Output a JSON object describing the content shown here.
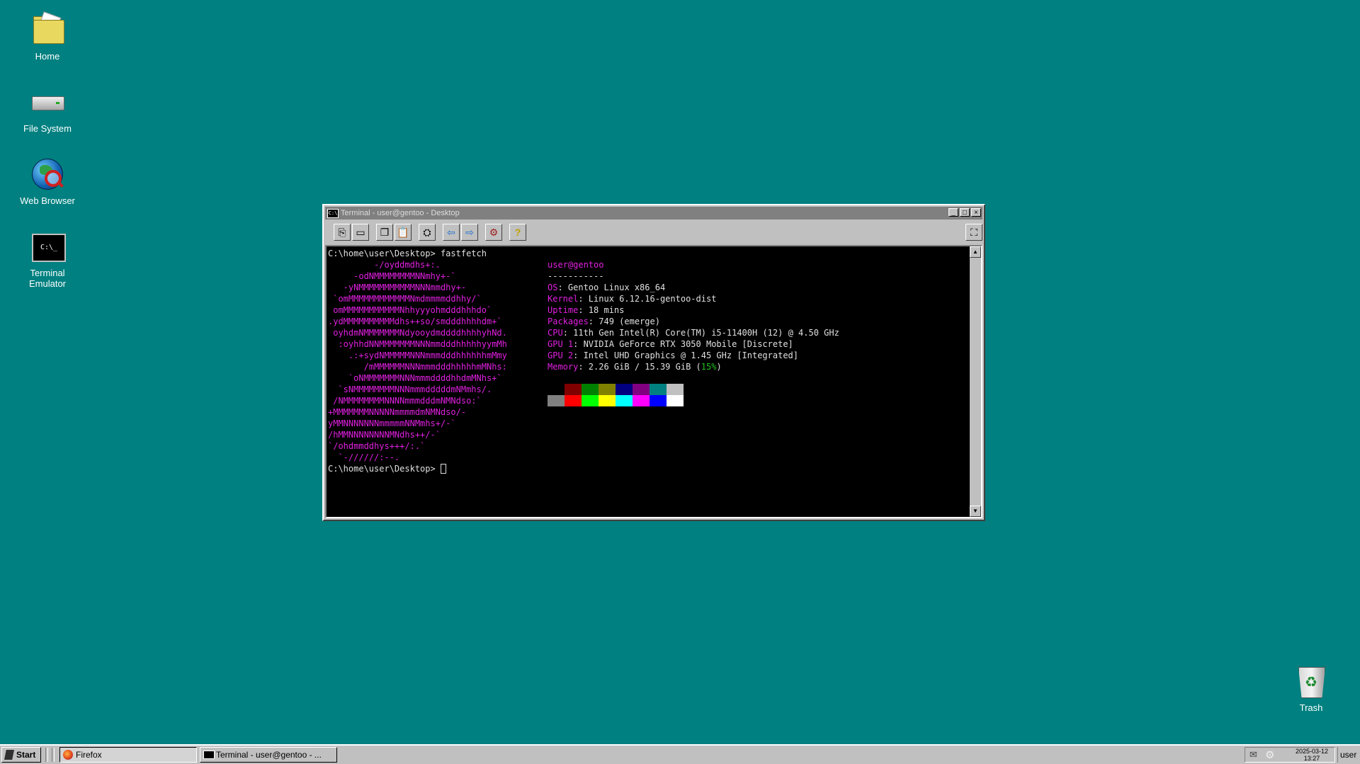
{
  "desktop": {
    "icons": [
      {
        "label": "Home",
        "icon": "folder-icon"
      },
      {
        "label": "File System",
        "icon": "drive-icon"
      },
      {
        "label": "Web Browser",
        "icon": "globe-icon"
      },
      {
        "label": "Terminal Emulator",
        "icon": "terminal-icon"
      },
      {
        "label": "Trash",
        "icon": "trash-icon"
      }
    ]
  },
  "terminal": {
    "title": "Terminal - user@gentoo - Desktop",
    "title_icon_text": "C:\\",
    "icon_text": "C:\\_",
    "prompt1": "C:\\home\\user\\Desktop> fastfetch",
    "prompt2": "C:\\home\\user\\Desktop> ",
    "logo_lines": [
      "         -/oyddmdhs+:.",
      "     -odNMMMMMMMMNNmhy+-`",
      "   -yNMMMMMMMMMMMNNNmmdhy+-",
      " `omMMMMMMMMMMMMNmdmmmmddhhy/`",
      " omMMMMMMMMMMMNhhyyyohmdddhhhdo`",
      ".ydMMMMMMMMMMdhs++so/smdddhhhhdm+`",
      " oyhdmNMMMMMMMNdyooydmddddhhhhyhNd.",
      "  :oyhhdNNMMMMMMMNNNmmdddhhhhhyymMh",
      "    .:+sydNMMMMMNNNmmmdddhhhhhhmMmy",
      "       /mMMMMMMNNNmmmdddhhhhhmMNhs:",
      "    `oNMMMMMMMNNNmmmddddhhdmMNhs+`",
      "  `sNMMMMMMMMNNNmmmdddddmNMmhs/.",
      " /NMMMMMMMMNNNNmmmdddmNMNdso:`",
      "+MMMMMMMNNNNNmmmmdmNMNdso/-",
      "yMMNNNNNNNmmmmmNNMmhs+/-`",
      "/hMMNNNNNNNNMNdhs++/-`",
      "`/ohdmmddhys+++/:.`",
      "  `-//////:--."
    ],
    "user_host": "user@gentoo",
    "separator": "-----------",
    "info": [
      {
        "key": "OS",
        "value": ": Gentoo Linux x86_64"
      },
      {
        "key": "Kernel",
        "value": ": Linux 6.12.16-gentoo-dist"
      },
      {
        "key": "Uptime",
        "value": ": 18 mins"
      },
      {
        "key": "Packages",
        "value": ": 749 (emerge)"
      },
      {
        "key": "CPU",
        "value": ": 11th Gen Intel(R) Core(TM) i5-11400H (12) @ 4.50 GHz"
      },
      {
        "key": "GPU 1",
        "value": ": NVIDIA GeForce RTX 3050 Mobile [Discrete]"
      },
      {
        "key": "GPU 2",
        "value": ": Intel UHD Graphics @ 1.45 GHz [Integrated]"
      },
      {
        "key": "Memory",
        "value": ": 2.26 GiB / 15.39 GiB (",
        "percent": "15%",
        "tail": ")"
      }
    ],
    "palette_row1": [
      "#000000",
      "#800000",
      "#008000",
      "#808000",
      "#000080",
      "#800080",
      "#008080",
      "#c0c0c0"
    ],
    "palette_row2": [
      "#808080",
      "#ff0000",
      "#00ff00",
      "#ffff00",
      "#00ffff",
      "#ff00ff",
      "#0000ff",
      "#ffffff"
    ],
    "toolbar_icons": [
      "new-tab-icon",
      "new-window-icon",
      "copy-icon",
      "paste-icon",
      "find-icon",
      "previous-tab-icon",
      "next-tab-icon",
      "preferences-icon",
      "help-icon",
      "fullscreen-icon"
    ]
  },
  "taskbar": {
    "start_label": "Start",
    "tasks": [
      {
        "label": "Firefox",
        "active": true
      },
      {
        "label": "Terminal - user@gentoo - ...",
        "active": false
      }
    ],
    "clock_date": "2025-03-12",
    "clock_time": "13:27",
    "user_label": "user"
  },
  "colors": {
    "desktop": "#008080",
    "accent_magenta": "#e020e0"
  }
}
